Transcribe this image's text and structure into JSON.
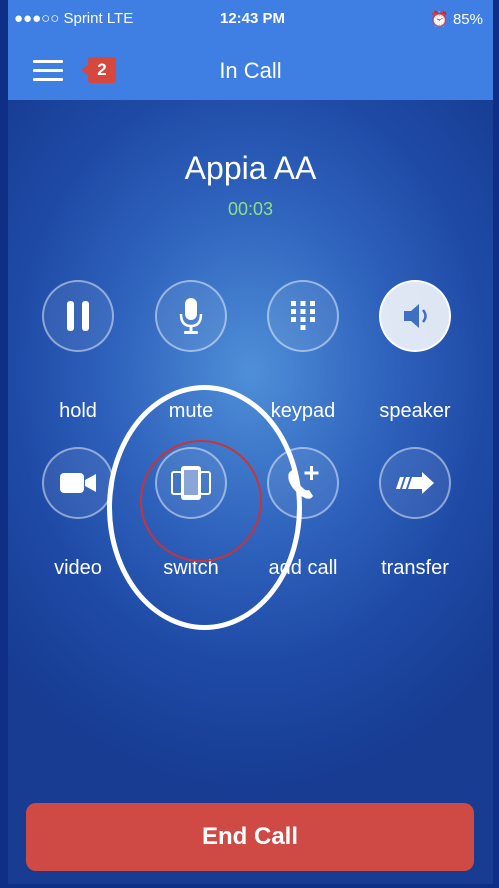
{
  "status_bar": {
    "carrier": "●●●○○ Sprint  LTE",
    "time": "12:43 PM",
    "battery": "⏰ 85%"
  },
  "nav": {
    "title": "In Call",
    "badge_count": "2"
  },
  "call": {
    "caller_name": "Appia AA",
    "duration": "00:03"
  },
  "buttons": {
    "hold": "hold",
    "mute": "mute",
    "keypad": "keypad",
    "speaker": "speaker",
    "video": "video",
    "switch": "switch",
    "add_call": "add call",
    "transfer": "transfer"
  },
  "end_call_label": "End Call",
  "colors": {
    "header": "#3f7ee2",
    "end_call": "#d04a45",
    "timer": "#8ee07e",
    "annotation_red": "#c7343a"
  }
}
